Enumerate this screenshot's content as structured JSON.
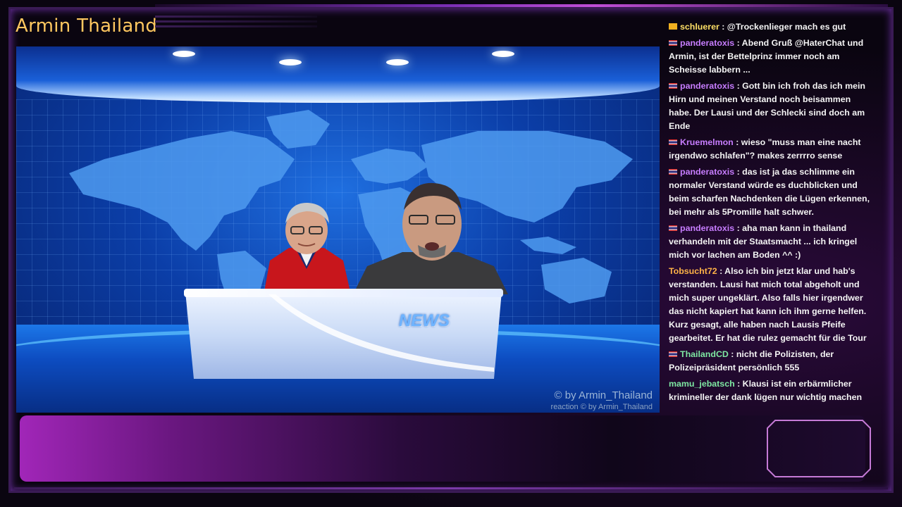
{
  "stream": {
    "title": "Armin Thailand"
  },
  "video": {
    "desk_text": "NEWS",
    "watermark_main": "© by Armin_Thailand",
    "watermark_sub": "reaction  © by Armin_Thailand"
  },
  "chat": {
    "messages": [
      {
        "user": "schluerer",
        "color": "#ffe066",
        "badge": "gold",
        "text": ": @Trockenlieger mach es gut"
      },
      {
        "user": "panderatoxis",
        "color": "#c77dff",
        "badge": "flag",
        "text": ": Abend Gruß @HaterChat und Armin, ist der Bettelprinz immer noch am Scheisse labbern ..."
      },
      {
        "user": "panderatoxis",
        "color": "#c77dff",
        "badge": "flag",
        "text": ": Gott bin ich froh das ich mein Hirn und meinen Verstand noch beisammen habe. Der Lausi und der Schlecki sind doch am Ende"
      },
      {
        "user": "Kruemelmon",
        "color": "#c77dff",
        "badge": "flag",
        "text": ": wieso \"muss man eine nacht irgendwo schlafen\"? makes zerrrro sense"
      },
      {
        "user": "panderatoxis",
        "color": "#c77dff",
        "badge": "flag",
        "text": ": das ist ja das schlimme ein normaler Verstand würde es duchblicken und beim scharfen Nachdenken die Lügen erkennen, bei mehr als 5Promille halt schwer."
      },
      {
        "user": "panderatoxis",
        "color": "#c77dff",
        "badge": "flag",
        "text": ": aha man kann in thailand verhandeln mit der Staatsmacht ... ich kringel mich vor lachen am Boden ^^ :)"
      },
      {
        "user": "Tobsucht72",
        "color": "#ffb347",
        "badge": "",
        "text": ": Also ich bin jetzt klar und hab's verstanden. Lausi hat mich total abgeholt und mich super ungeklärt. Also falls hier irgendwer das nicht kapiert hat kann ich ihm gerne helfen. Kurz gesagt, alle haben nach Lausis Pfeife gearbeitet. Er hat die rulez gemacht für die Tour"
      },
      {
        "user": "ThailandCD",
        "color": "#7ee8a2",
        "badge": "flag",
        "text": ": nicht die Polizisten, der Polizeipräsident persönlich 555"
      },
      {
        "user": "mamu_jebatsch",
        "color": "#7ee8a2",
        "badge": "",
        "text": ": Klausi ist ein erbärmlicher krimineller der dank lügen nur wichtig machen kann sonst nimmt ihm keiner ernst den Bettler!"
      }
    ]
  },
  "colors": {
    "title": "#ffc860",
    "accent": "#7a2fb5"
  }
}
